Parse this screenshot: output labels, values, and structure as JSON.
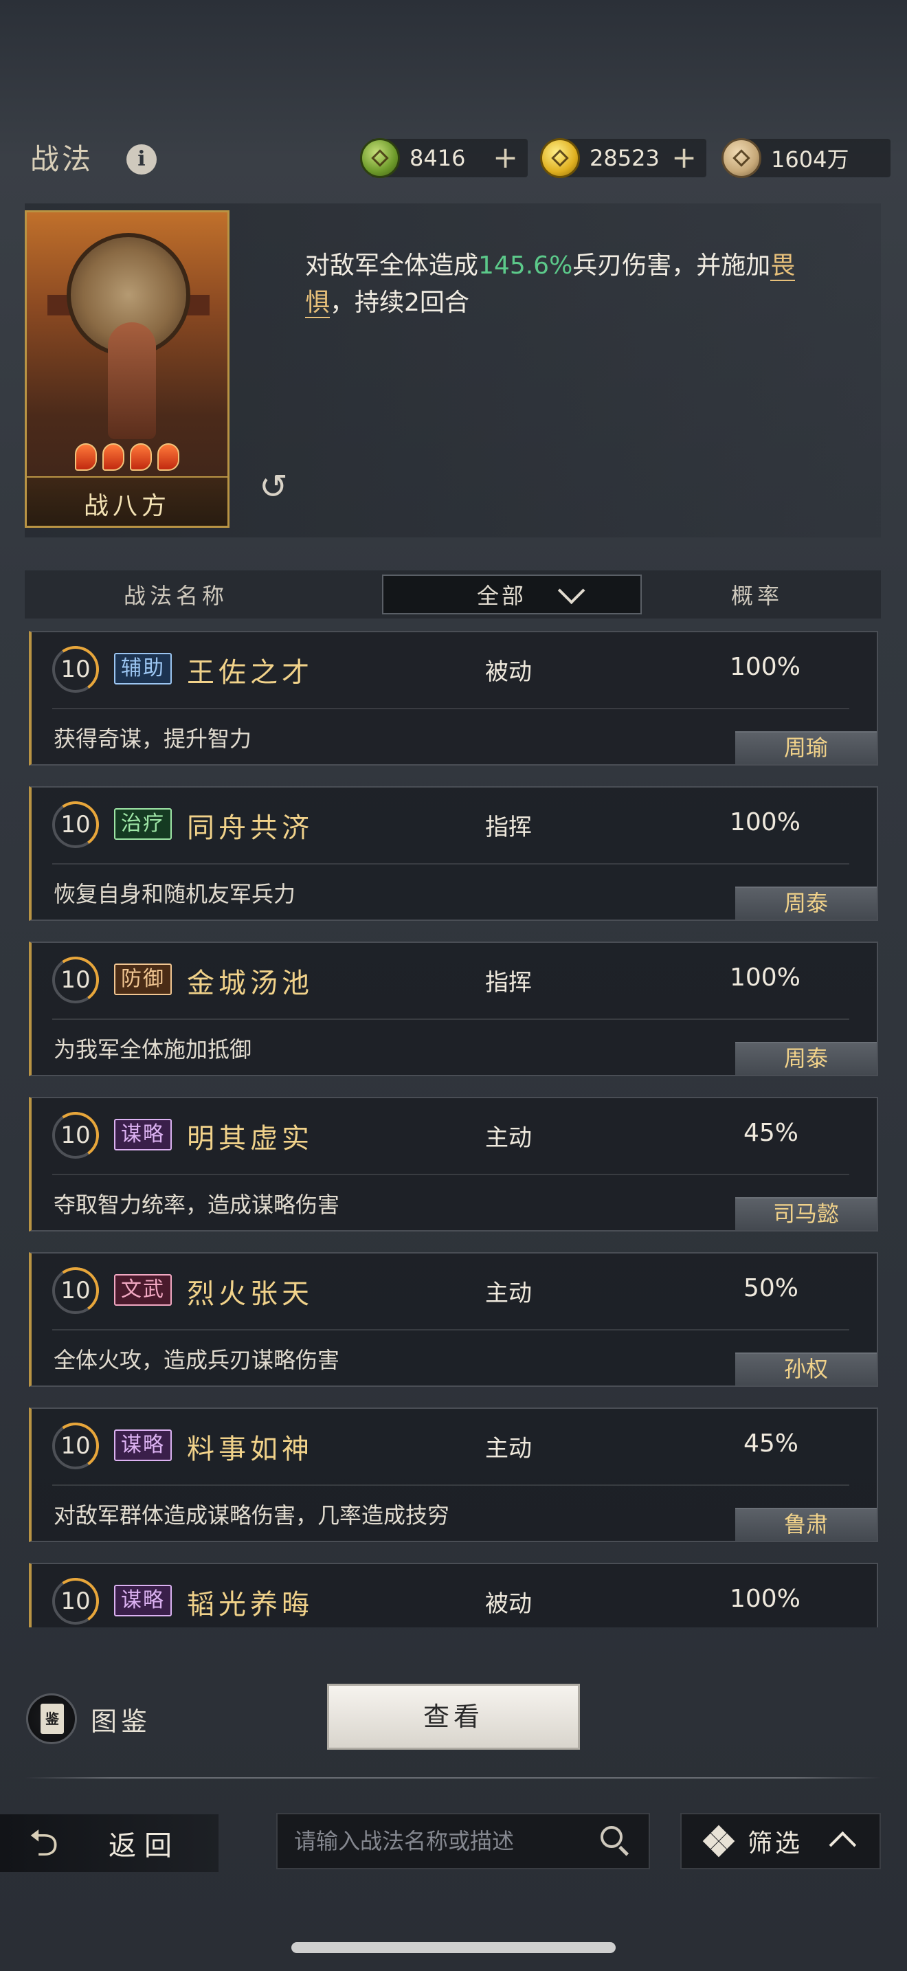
{
  "header": {
    "title": "战法",
    "info_icon": "info-icon",
    "resources": [
      {
        "icon": "jade-coin-icon",
        "value": "8416",
        "plus": "+"
      },
      {
        "icon": "gold-coin-icon",
        "value": "28523",
        "plus": "+"
      },
      {
        "icon": "copper-coin-icon",
        "value": "1604万"
      }
    ]
  },
  "skill_card": {
    "name": "战八方",
    "description_parts": [
      "对敌军全体造成",
      "145.6%",
      "兵刃伤害，并施加",
      "畏惧",
      "，持续2回合"
    ]
  },
  "columns": {
    "name": "战法名称",
    "filter": "全部",
    "rate": "概率"
  },
  "skills": [
    {
      "level": "10",
      "tag": "辅助",
      "tag_color": "blue",
      "name": "王佐之才",
      "type": "被动",
      "rate": "100%",
      "desc": "获得奇谋，提升智力",
      "general": "周瑜"
    },
    {
      "level": "10",
      "tag": "治疗",
      "tag_color": "green",
      "name": "同舟共济",
      "type": "指挥",
      "rate": "100%",
      "desc": "恢复自身和随机友军兵力",
      "general": "周泰"
    },
    {
      "level": "10",
      "tag": "防御",
      "tag_color": "orange",
      "name": "金城汤池",
      "type": "指挥",
      "rate": "100%",
      "desc": "为我军全体施加抵御",
      "general": "周泰"
    },
    {
      "level": "10",
      "tag": "谋略",
      "tag_color": "purple",
      "name": "明其虚实",
      "type": "主动",
      "rate": "45%",
      "desc": "夺取智力统率，造成谋略伤害",
      "general": "司马懿"
    },
    {
      "level": "10",
      "tag": "文武",
      "tag_color": "red",
      "name": "烈火张天",
      "type": "主动",
      "rate": "50%",
      "desc": "全体火攻，造成兵刃谋略伤害",
      "general": "孙权"
    },
    {
      "level": "10",
      "tag": "谋略",
      "tag_color": "purple",
      "name": "料事如神",
      "type": "主动",
      "rate": "45%",
      "desc": "对敌军群体造成谋略伤害，几率造成技穷",
      "general": "鲁肃"
    },
    {
      "level": "10",
      "tag": "谋略",
      "tag_color": "purple",
      "name": "韬光养晦",
      "type": "被动",
      "rate": "100%"
    }
  ],
  "bottom": {
    "codex_label": "图鉴",
    "codex_icon_text": "鉴",
    "view_button": "查看",
    "back_label": "返回",
    "search_placeholder": "请输入战法名称或描述",
    "filter_label": "筛选"
  }
}
